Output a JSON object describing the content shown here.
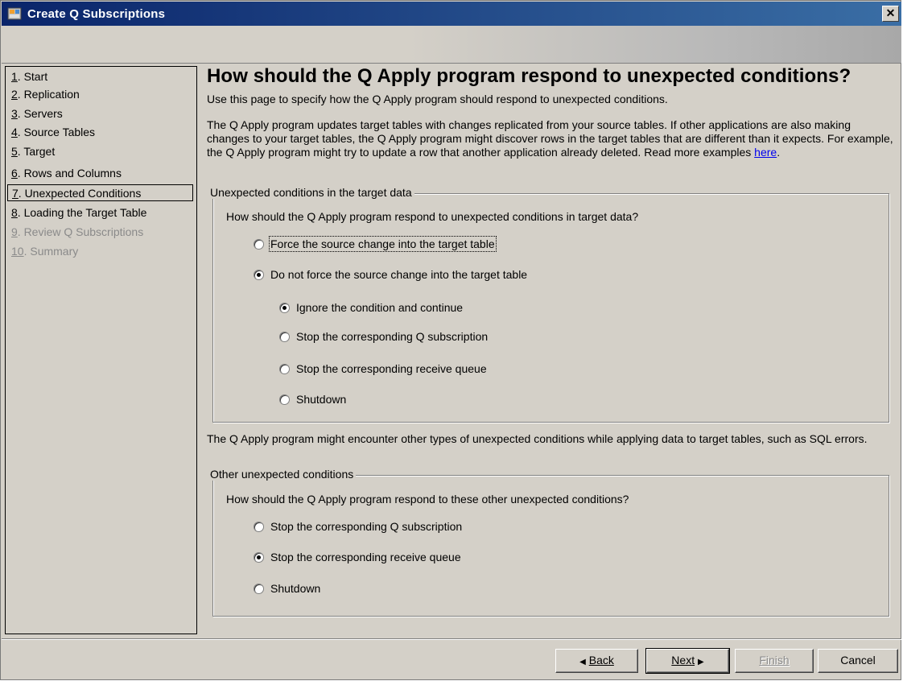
{
  "window": {
    "title": "Create Q Subscriptions",
    "close_glyph": "✕"
  },
  "sidebar": {
    "items": [
      {
        "num": "1",
        "label": ". Start",
        "state": "normal"
      },
      {
        "num": "2",
        "label": ". Replication",
        "state": "normal"
      },
      {
        "num": "3",
        "label": ". Servers",
        "state": "normal"
      },
      {
        "num": "4",
        "label": ". Source Tables",
        "state": "normal"
      },
      {
        "num": "5",
        "label": ". Target",
        "state": "normal"
      },
      {
        "num": "6",
        "label": ". Rows and Columns",
        "state": "normal"
      },
      {
        "num": "7",
        "label": ". Unexpected Conditions",
        "state": "active"
      },
      {
        "num": "8",
        "label": ". Loading the Target Table",
        "state": "normal"
      },
      {
        "num": "9",
        "label": ". Review Q Subscriptions",
        "state": "disabled"
      },
      {
        "num": "10",
        "label": ". Summary",
        "state": "disabled"
      }
    ]
  },
  "main": {
    "title": "How should the Q Apply program respond to unexpected conditions?",
    "intro": "Use this page to specify how the Q Apply program should respond to unexpected conditions.",
    "paragraph": "The Q Apply program updates target tables with changes replicated from your source tables. If other applications are also making changes to your target tables, the Q Apply program might discover rows in the target tables that are different than it expects. For example, the Q Apply program might try to update a row that another application already deleted. Read more examples ",
    "paragraph_link": "here",
    "paragraph_end": ".",
    "target_group": {
      "legend": "Unexpected conditions in the target data",
      "question": "How should the Q Apply program respond to unexpected conditions in target data?",
      "force_option": "Force the source change into the target table",
      "no_force_option": "Do not force the source change into the target table",
      "sub_options": [
        {
          "label": "Ignore the condition and continue",
          "checked": true
        },
        {
          "label": "Stop the corresponding Q subscription",
          "checked": false
        },
        {
          "label": "Stop the corresponding receive queue",
          "checked": false
        },
        {
          "label": "Shutdown",
          "checked": false
        }
      ]
    },
    "other_paragraph": "The Q Apply program might encounter other types of unexpected conditions while applying data to target tables, such as SQL errors.",
    "other_group": {
      "legend": "Other unexpected conditions",
      "question": "How should the Q Apply program respond to these other unexpected conditions?",
      "options": [
        {
          "label": "Stop the corresponding Q subscription",
          "checked": false
        },
        {
          "label": "Stop the corresponding receive queue",
          "checked": true
        },
        {
          "label": "Shutdown",
          "checked": false
        }
      ]
    }
  },
  "buttons": {
    "back": "Back",
    "back_glyph": "◀",
    "next": "Next",
    "next_glyph": "▶",
    "finish": "Finish",
    "cancel": "Cancel"
  }
}
